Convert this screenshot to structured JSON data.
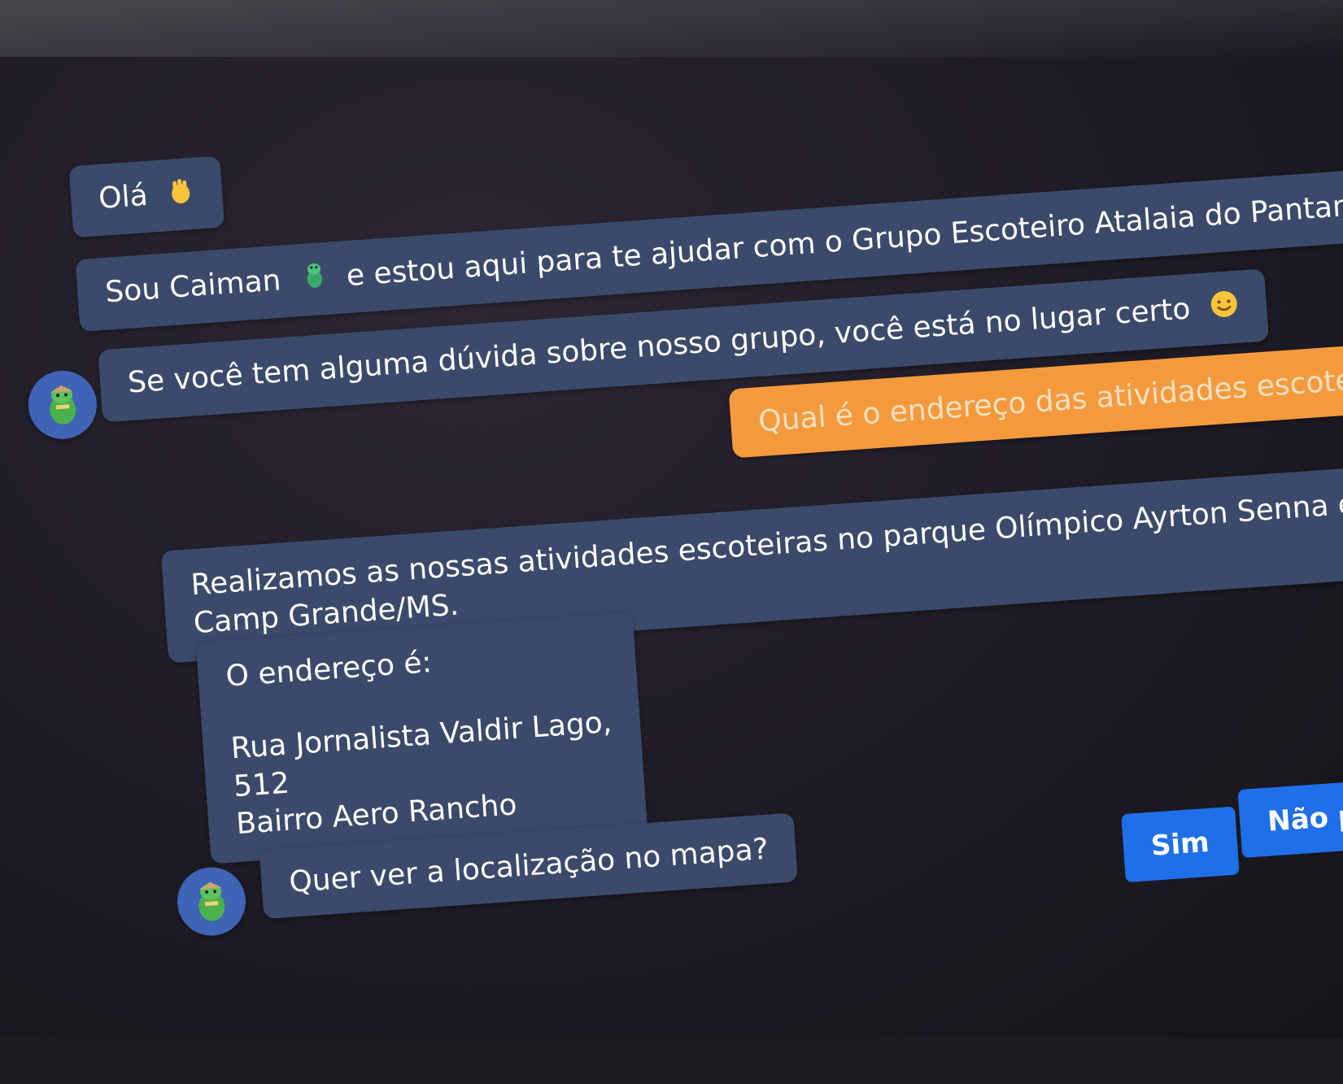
{
  "bot": {
    "avatar_icon": "crocodile-scout-icon",
    "colors": {
      "bot_bubble": "#3b4a6b",
      "user_bubble": "#f59a3c",
      "button": "#1f6fe8",
      "avatar_bg": "#3f63b5"
    }
  },
  "messages": [
    {
      "text": "Olá",
      "icon": "waving-hand-icon"
    },
    {
      "text_before": "Sou Caiman",
      "icon": "crocodile-icon",
      "text_after": "e estou aqui para te ajudar com o Grupo Escoteiro Atalaia do Pantanal"
    },
    {
      "text": "Se você tem alguma dúvida sobre nosso grupo, você está no lugar certo",
      "icon": "smiling-face-icon"
    },
    {
      "text": "Qual é o endereço das atividades escote"
    },
    {
      "text": "Realizamos as nossas atividades escoteiras no parque Olímpico Ayrton Senna em Camp Grande/MS."
    },
    {
      "line1": "O endereço é:",
      "line2": "Rua Jornalista Valdir Lago, 512",
      "line3": "Bairro Aero Rancho"
    },
    {
      "text": "Quer ver a localização no mapa?"
    }
  ],
  "quick_replies": {
    "yes_label": "Sim",
    "no_label": "Não pr"
  }
}
